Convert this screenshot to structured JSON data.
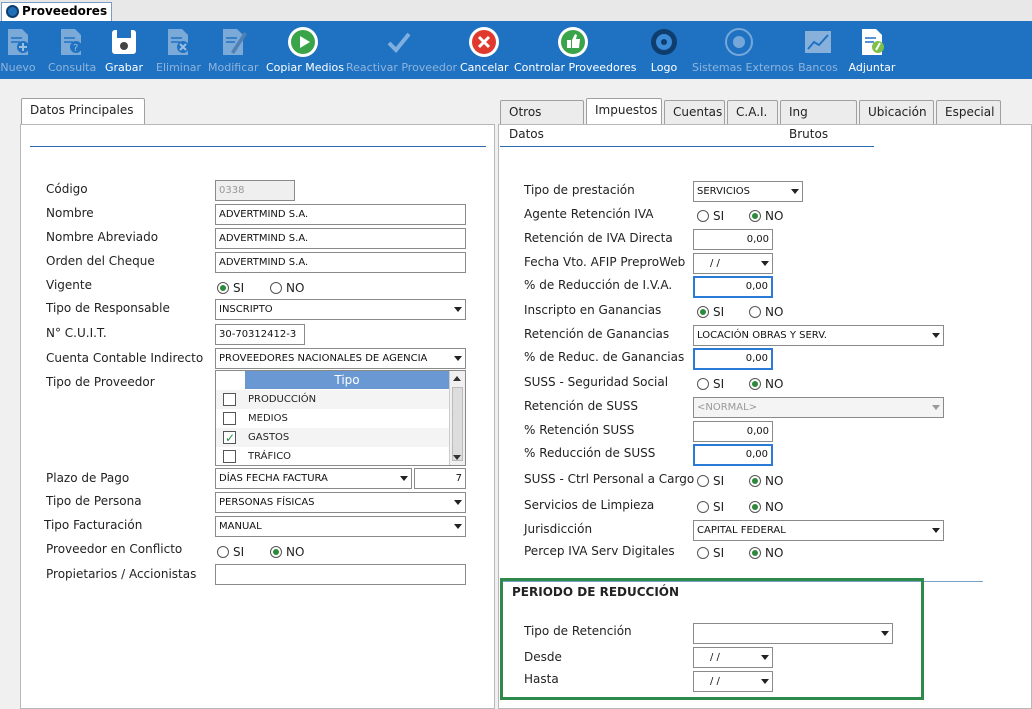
{
  "window": {
    "tab_title": "Proveedores"
  },
  "toolbar": [
    {
      "label": "Nuevo",
      "icon": "new-doc-icon",
      "disabled": true
    },
    {
      "label": "Consulta",
      "icon": "query-doc-icon",
      "disabled": true
    },
    {
      "label": "Grabar",
      "icon": "save-icon",
      "disabled": false
    },
    {
      "label": "Eliminar",
      "icon": "delete-doc-icon",
      "disabled": true
    },
    {
      "label": "Modificar",
      "icon": "edit-doc-icon",
      "disabled": true
    },
    {
      "label": "Copiar Medios",
      "icon": "play-circle-icon",
      "disabled": false
    },
    {
      "label": "Reactivar Proveedor",
      "icon": "checkmark-icon",
      "disabled": true
    },
    {
      "label": "Cancelar",
      "icon": "cancel-icon",
      "disabled": false
    },
    {
      "label": "Controlar Proveedores",
      "icon": "thumbs-up-icon",
      "disabled": false
    },
    {
      "label": "Logo",
      "icon": "logo-icon",
      "disabled": false
    },
    {
      "label": "Sistemas Externos",
      "icon": "external-systems-icon",
      "disabled": true
    },
    {
      "label": "Bancos",
      "icon": "bank-chart-icon",
      "disabled": true
    },
    {
      "label": "Adjuntar",
      "icon": "attach-doc-icon",
      "disabled": false
    }
  ],
  "left": {
    "tab": "Datos Principales",
    "fields": {
      "codigo": {
        "label": "Código",
        "value": "0338"
      },
      "nombre": {
        "label": "Nombre",
        "value": "ADVERTMIND S.A."
      },
      "nombre_abreviado": {
        "label": "Nombre Abreviado",
        "value": "ADVERTMIND S.A."
      },
      "orden_cheque": {
        "label": "Orden del Cheque",
        "value": "ADVERTMIND S.A."
      },
      "vigente": {
        "label": "Vigente",
        "si": "SI",
        "no": "NO",
        "selected": "SI"
      },
      "tipo_responsable": {
        "label": "Tipo de Responsable",
        "value": "INSCRIPTO"
      },
      "cuit": {
        "label": "N° C.U.I.T.",
        "value": "30-70312412-3"
      },
      "cuenta_contable": {
        "label": "Cuenta Contable Indirecto",
        "value": "PROVEEDORES NACIONALES DE AGENCIA"
      },
      "tipo_proveedor": {
        "label": "Tipo de Proveedor",
        "header": "Tipo",
        "items": [
          {
            "label": "PRODUCCIÓN",
            "checked": false
          },
          {
            "label": "MEDIOS",
            "checked": false
          },
          {
            "label": "GASTOS",
            "checked": true
          },
          {
            "label": "TRÁFICO",
            "checked": false
          }
        ]
      },
      "plazo_pago": {
        "label": "Plazo de Pago",
        "value": "DÍAS FECHA FACTURA",
        "days": "7"
      },
      "tipo_persona": {
        "label": "Tipo de Persona",
        "value": "PERSONAS FÍSICAS"
      },
      "tipo_facturacion": {
        "label": "Tipo Facturación",
        "value": "MANUAL"
      },
      "conflicto": {
        "label": "Proveedor en Conflicto",
        "si": "SI",
        "no": "NO",
        "selected": "NO"
      },
      "propietarios": {
        "label": "Propietarios / Accionistas",
        "value": ""
      }
    }
  },
  "right": {
    "tabs": [
      "Otros Datos",
      "Impuestos",
      "Cuentas",
      "C.A.I.",
      "Ing Brutos",
      "Ubicación",
      "Especial"
    ],
    "active_tab": "Impuestos",
    "fields": {
      "tipo_prestacion": {
        "label": "Tipo de prestación",
        "value": "SERVICIOS"
      },
      "agente_ret_iva": {
        "label": "Agente Retención IVA",
        "si": "SI",
        "no": "NO",
        "selected": "NO"
      },
      "ret_iva_directa": {
        "label": "Retención de IVA Directa",
        "value": "0,00"
      },
      "fecha_afip": {
        "label": "Fecha Vto. AFIP PreproWeb",
        "value": " /  /"
      },
      "red_iva": {
        "label": "% de Reducción de I.V.A.",
        "value": "0,00"
      },
      "inscripto_ganancias": {
        "label": "Inscripto en Ganancias",
        "si": "SI",
        "no": "NO",
        "selected": "SI"
      },
      "ret_ganancias": {
        "label": "Retención de Ganancias",
        "value": "LOCACIÓN OBRAS Y SERV."
      },
      "red_ganancias": {
        "label": "% de Reduc. de Ganancias",
        "value": "0,00"
      },
      "suss": {
        "label": "SUSS - Seguridad Social",
        "si": "SI",
        "no": "NO",
        "selected": "NO"
      },
      "ret_suss": {
        "label": "Retención de SUSS",
        "value": "<NORMAL>"
      },
      "pct_ret_suss": {
        "label": "% Retención SUSS",
        "value": "0,00"
      },
      "red_suss": {
        "label": "% Reducción de SUSS",
        "value": "0,00"
      },
      "suss_ctrl": {
        "label": "SUSS - Ctrl Personal a Cargo",
        "si": "SI",
        "no": "NO",
        "selected": "NO"
      },
      "servicios_limpieza": {
        "label": "Servicios de Limpieza",
        "si": "SI",
        "no": "NO",
        "selected": "NO"
      },
      "jurisdiccion": {
        "label": "Jurisdicción",
        "value": "CAPITAL FEDERAL"
      },
      "percep_iva": {
        "label": "Percep IVA Serv Digitales",
        "si": "SI",
        "no": "NO",
        "selected": "NO"
      }
    },
    "periodo": {
      "title": "PERIODO DE REDUCCIÓN",
      "tipo_retencion": {
        "label": "Tipo de Retención",
        "value": ""
      },
      "desde": {
        "label": "Desde",
        "value": " /  /"
      },
      "hasta": {
        "label": "Hasta",
        "value": " /  /"
      }
    }
  }
}
